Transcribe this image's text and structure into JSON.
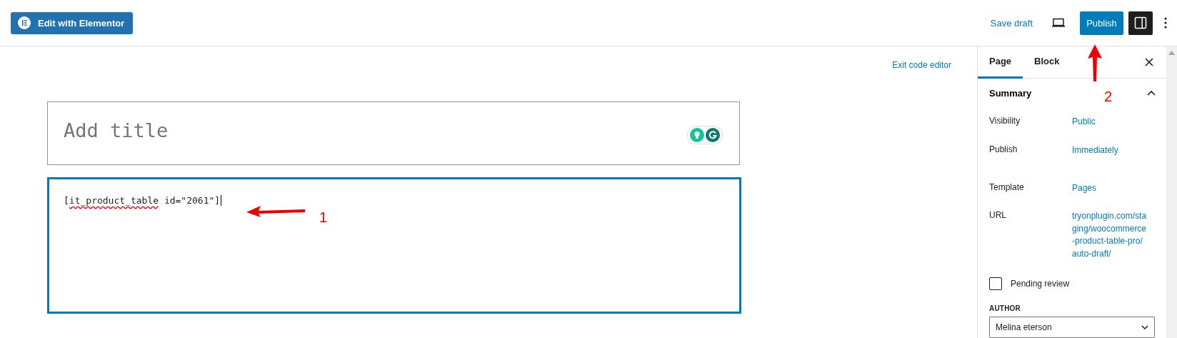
{
  "toolbar": {
    "elementor_button": "Edit with Elementor",
    "save_draft": "Save draft",
    "publish": "Publish",
    "sidebar_open": true
  },
  "editor": {
    "exit_code_editor": "Exit code editor",
    "title_placeholder": "Add title",
    "focused": true,
    "code": {
      "before": "[",
      "flagged_word": "it_product_table",
      "after": " id=\"2061\"]",
      "spellcheck_flag": true
    }
  },
  "sidebar": {
    "tabs": [
      {
        "label": "Page",
        "selected": true
      },
      {
        "label": "Block",
        "selected": false
      }
    ],
    "panel": {
      "title": "Summary",
      "expanded": true
    },
    "rows": [
      {
        "label": "Visibility",
        "value": "Public"
      },
      {
        "label": "Publish",
        "value": "Immediately"
      },
      {
        "label": "Template",
        "value": "Pages"
      },
      {
        "label": "URL",
        "value": "tryonplugin.com/staging/woocommerce-product-table-pro/auto-draft/"
      }
    ],
    "pending_review": {
      "label": "Pending review",
      "checked": false
    },
    "author": {
      "label": "AUTHOR",
      "value": "Melina eterson"
    }
  },
  "annotations": [
    {
      "label": "1",
      "kind": "left"
    },
    {
      "label": "2",
      "kind": "up"
    }
  ]
}
